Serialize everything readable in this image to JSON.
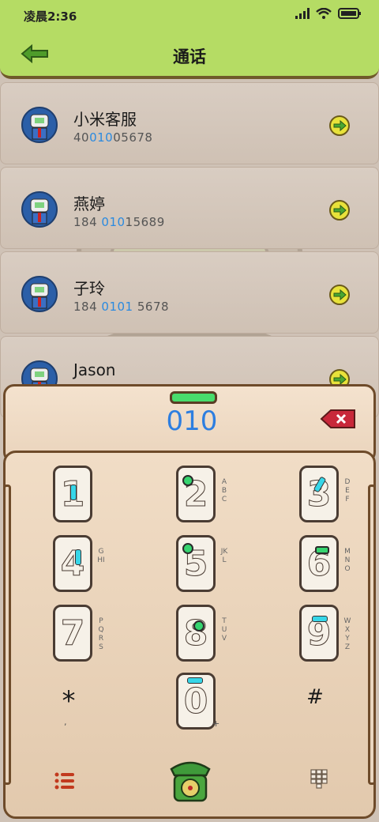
{
  "status": {
    "time": "凌晨2:36"
  },
  "header": {
    "title": "通话"
  },
  "contacts": [
    {
      "name": "小米客服",
      "num_pre": "40",
      "num_hl": "010",
      "num_post": "05678"
    },
    {
      "name": "燕婷",
      "num_pre": "184 ",
      "num_hl": "010",
      "num_post": "15689"
    },
    {
      "name": "子玲",
      "num_pre": "184 ",
      "num_hl": "0101",
      "num_post": " 5678"
    },
    {
      "name": "Jason",
      "num_pre": "",
      "num_hl": "",
      "num_post": ""
    }
  ],
  "dialer": {
    "input": "010"
  },
  "keys": [
    {
      "digit": "1",
      "letters": ""
    },
    {
      "digit": "2",
      "letters": "ABC"
    },
    {
      "digit": "3",
      "letters": "DEF"
    },
    {
      "digit": "4",
      "letters": "GHI"
    },
    {
      "digit": "5",
      "letters": "JKL"
    },
    {
      "digit": "6",
      "letters": "MNO"
    },
    {
      "digit": "7",
      "letters": "PQRS"
    },
    {
      "digit": "8",
      "letters": "TUV"
    },
    {
      "digit": "9",
      "letters": "WXYZ"
    },
    {
      "digit": "*",
      "letters": ","
    },
    {
      "digit": "0",
      "letters": "+"
    },
    {
      "digit": "#",
      "letters": ""
    }
  ],
  "icons": {
    "back": "arrow-left-icon",
    "goto": "arrow-right-circle-icon",
    "delete": "backspace-icon",
    "menu": "list-icon",
    "call": "telephone-icon",
    "keypad": "dialpad-icon"
  },
  "colors": {
    "accent": "#2d7ee0",
    "header": "#b5dc64",
    "highlight": "#2a8ae0"
  }
}
